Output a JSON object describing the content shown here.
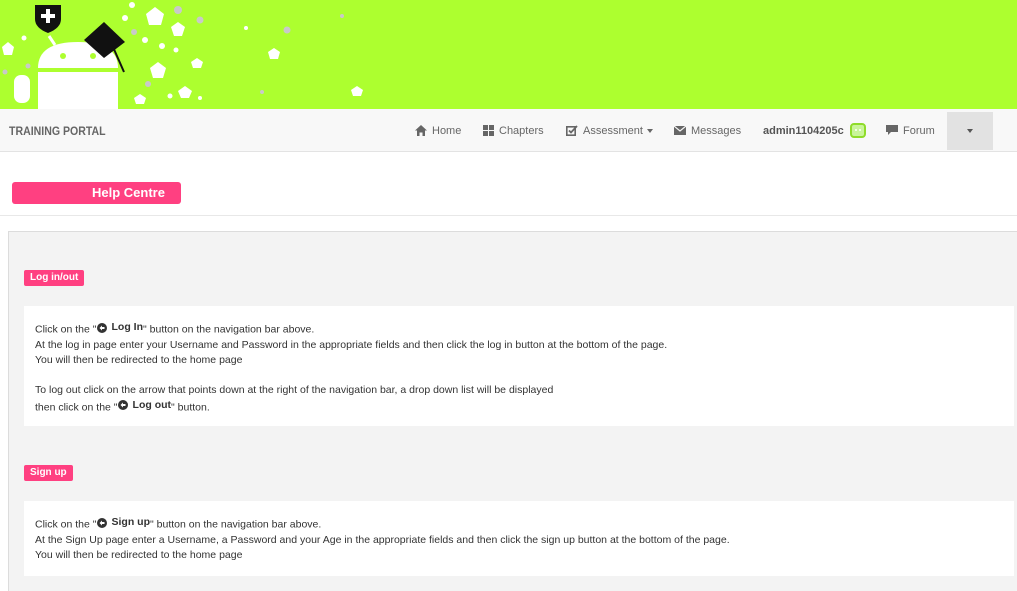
{
  "header": {
    "brand": "TRAINING PORTAL"
  },
  "nav": {
    "home": "Home",
    "chapters": "Chapters",
    "assessment": "Assessment",
    "messages": "Messages",
    "user": "admin1104205c",
    "forum": "Forum"
  },
  "page": {
    "title": "Help Centre"
  },
  "sections": {
    "login": {
      "tag": "Log in/out",
      "line1_pre": "Click on the  \"",
      "line1_btn": "Log In",
      "line1_post": "\"  button on the navigation bar above.",
      "line2": "At the log in page enter your Username and Password in the appropriate fields and then click the log in button at the bottom of the page.",
      "line3": "You will then be redirected to the home page",
      "line4": "To log out click on the arrow that points down at the right of the navigation bar, a drop down list will be displayed",
      "line5_pre": "then click on the  \"",
      "line5_btn": "Log out",
      "line5_post": "\"  button."
    },
    "signup": {
      "tag": "Sign up",
      "line1_pre": "Click on the  \"",
      "line1_btn": "Sign up",
      "line1_post": "\"  button on the navigation bar above.",
      "line2": "At the Sign Up page enter a Username, a Password and your Age in the appropriate fields and then click the sign up button at the bottom of the page.",
      "line3": "You will then be redirected to the home page"
    }
  },
  "colors": {
    "banner": "#adff2f",
    "accent": "#ff4081",
    "navbar": "#f8f8f8"
  },
  "icons": [
    "swiss-shield-icon",
    "android-graduate-icon",
    "home-icon",
    "chapters-grid-icon",
    "assessment-check-icon",
    "messages-envelope-icon",
    "user-badge-icon",
    "forum-comment-icon",
    "circle-arrow-icon"
  ]
}
